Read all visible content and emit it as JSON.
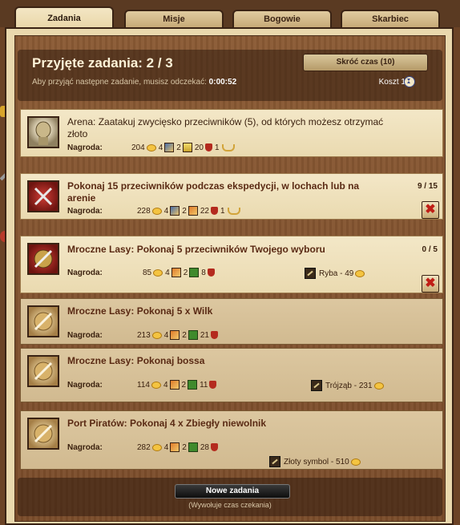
{
  "tabs": [
    {
      "label": "Zadania",
      "active": true
    },
    {
      "label": "Misje",
      "active": false
    },
    {
      "label": "Bogowie",
      "active": false
    },
    {
      "label": "Skarbiec",
      "active": false
    }
  ],
  "header": {
    "title": "Przyjęte zadania: 2 / 3",
    "wait_text": "Aby przyjąć następne zadanie, musisz odczekać:",
    "wait_time": "0:00:52",
    "shorten_label": "Skróć czas (10)",
    "cost_label": "Koszt 1"
  },
  "reward_label": "Nagroda:",
  "quests": [
    {
      "title": "Arena: Zaatakuj zwycięsko przeciwników (5), od których możesz otrzymać złoto",
      "gold": "204",
      "xp": "4",
      "honor": "2",
      "fame": "20",
      "rubies": "1",
      "state": "available",
      "portrait": "arena-helmet-icon"
    },
    {
      "title": "Pokonaj 15 przeciwników podczas ekspedycji, w lochach lub na arenie",
      "gold": "228",
      "xp": "4",
      "honor": "2",
      "fame": "22",
      "rubies": "1",
      "progress": "9 / 15",
      "state": "accepted",
      "portrait": "crossed-swords-icon"
    },
    {
      "title": "Mroczne Lasy: Pokonaj 5 przeciwników Twojego wyboru",
      "gold": "85",
      "xp": "4",
      "honor": "2",
      "fame": "8",
      "progress": "0 / 5",
      "item": "Ryba - 49",
      "state": "accepted",
      "portrait": "sword-shield-icon"
    },
    {
      "title": "Mroczne Lasy: Pokonaj 5 x Wilk",
      "gold": "213",
      "xp": "4",
      "honor": "2",
      "fame": "21",
      "state": "faded",
      "portrait": "sword-shield-icon"
    },
    {
      "title": "Mroczne Lasy: Pokonaj bossa",
      "gold": "114",
      "xp": "4",
      "honor": "2",
      "fame": "11",
      "item": "Trójząb - 231",
      "state": "faded",
      "portrait": "sword-shield-icon"
    },
    {
      "title": "Port Piratów: Pokonaj 4 x Zbiegły niewolnik",
      "gold": "282",
      "xp": "4",
      "honor": "2",
      "fame": "28",
      "item": "Złoty symbol - 510",
      "state": "faded",
      "portrait": "sword-shield-icon"
    }
  ],
  "footer": {
    "new_button": "Nowe zadania",
    "note": "(Wywołuje czas czekania)"
  },
  "colors": {
    "title_red": "#5a2a14",
    "cancel_red": "#c01e16",
    "gold": "#f4c441",
    "wood": "#7a4c2a"
  }
}
